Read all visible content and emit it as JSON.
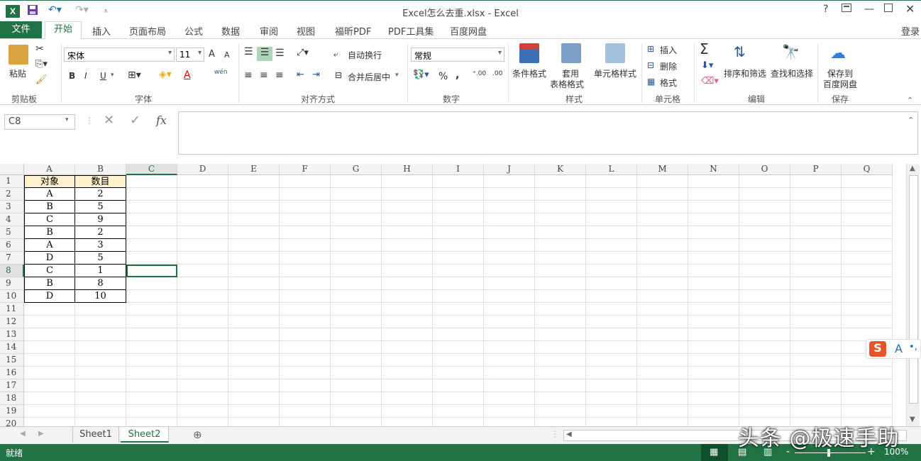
{
  "window": {
    "title": "Excel怎么去重.xlsx - Excel",
    "logo": "X",
    "help": "?",
    "login": "登录"
  },
  "tabs": {
    "file": "文件",
    "items": [
      "开始",
      "插入",
      "页面布局",
      "公式",
      "数据",
      "审阅",
      "视图",
      "福昕PDF",
      "PDF工具集",
      "百度网盘"
    ]
  },
  "ribbon": {
    "clipboard": {
      "paste": "粘贴",
      "label": "剪贴板"
    },
    "font": {
      "name": "宋体",
      "size": "11",
      "label": "字体",
      "bold": "B",
      "italic": "I",
      "underline": "U",
      "grow": "A",
      "shrink": "A",
      "color_a": "A",
      "wen": "wén"
    },
    "align": {
      "wrap": "自动换行",
      "merge": "合并后居中",
      "label": "对齐方式"
    },
    "number": {
      "format": "常规",
      "percent": "%",
      "comma": ",",
      "label": "数字"
    },
    "styles": {
      "cond": "条件格式",
      "table1": "套用",
      "table2": "表格格式",
      "cell": "单元格样式",
      "label": "样式"
    },
    "cells": {
      "insert": "插入",
      "delete": "删除",
      "format": "格式",
      "label": "单元格"
    },
    "edit": {
      "sort": "排序和筛选",
      "find": "查找和选择",
      "label": "编辑"
    },
    "save": {
      "line1": "保存到",
      "line2": "百度网盘",
      "label": "保存"
    }
  },
  "formula_bar": {
    "namebox": "C8",
    "cancel": "✕",
    "enter": "✓",
    "fx": "fx",
    "value": ""
  },
  "columns": [
    "A",
    "B",
    "C",
    "D",
    "E",
    "F",
    "G",
    "H",
    "I",
    "J",
    "K",
    "L",
    "M",
    "N",
    "O",
    "P",
    "Q"
  ],
  "rows": [
    "1",
    "2",
    "3",
    "4",
    "5",
    "6",
    "7",
    "8",
    "9",
    "10",
    "11",
    "12",
    "13",
    "14",
    "15",
    "16",
    "17",
    "18",
    "19",
    "20"
  ],
  "table": {
    "headers": [
      "对象",
      "数目"
    ],
    "data": [
      [
        "A",
        "2"
      ],
      [
        "B",
        "5"
      ],
      [
        "C",
        "9"
      ],
      [
        "B",
        "2"
      ],
      [
        "A",
        "3"
      ],
      [
        "D",
        "5"
      ],
      [
        "C",
        "1"
      ],
      [
        "B",
        "8"
      ],
      [
        "D",
        "10"
      ]
    ]
  },
  "active_cell": "C8",
  "sheets": [
    "Sheet1",
    "Sheet2"
  ],
  "active_sheet": "Sheet2",
  "status": {
    "ready": "就绪",
    "zoom": "100%",
    "zoom_minus": "-",
    "zoom_plus": "+"
  },
  "ime": {
    "s": "S",
    "a": "A",
    "dots": "•,"
  },
  "watermark": "头条 @极速手助",
  "colors": {
    "accent": "#217346",
    "header_fill": "#fff2cc"
  }
}
